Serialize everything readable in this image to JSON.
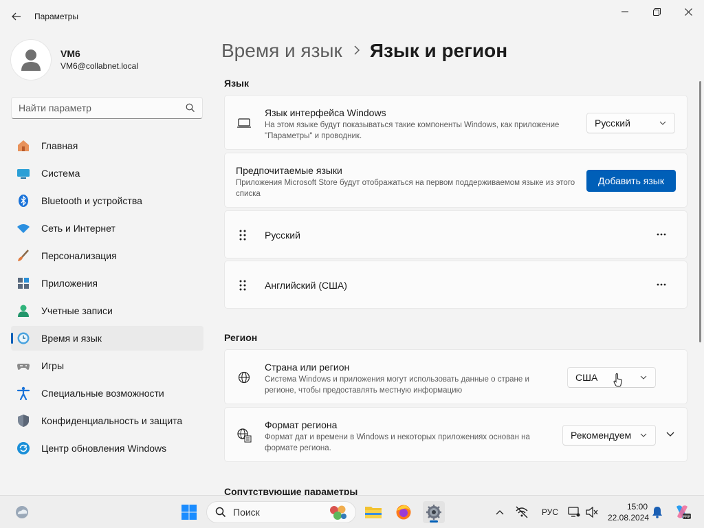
{
  "window": {
    "title": "Параметры"
  },
  "profile": {
    "name": "VM6",
    "email": "VM6@collabnet.local"
  },
  "search": {
    "placeholder": "Найти параметр"
  },
  "nav": {
    "items": [
      {
        "label": "Главная",
        "icon": "home-icon"
      },
      {
        "label": "Система",
        "icon": "system-icon"
      },
      {
        "label": "Bluetooth и устройства",
        "icon": "bluetooth-icon"
      },
      {
        "label": "Сеть и Интернет",
        "icon": "wifi-icon"
      },
      {
        "label": "Персонализация",
        "icon": "brush-icon"
      },
      {
        "label": "Приложения",
        "icon": "apps-icon"
      },
      {
        "label": "Учетные записи",
        "icon": "accounts-icon"
      },
      {
        "label": "Время и язык",
        "icon": "time-language-icon",
        "active": true
      },
      {
        "label": "Игры",
        "icon": "gamepad-icon"
      },
      {
        "label": "Специальные возможности",
        "icon": "accessibility-icon"
      },
      {
        "label": "Конфиденциальность и защита",
        "icon": "shield-icon"
      },
      {
        "label": "Центр обновления Windows",
        "icon": "update-icon"
      }
    ]
  },
  "breadcrumb": {
    "parent": "Время и язык",
    "current": "Язык и регион"
  },
  "language_section": {
    "title": "Язык",
    "display_language": {
      "title": "Язык интерфейса Windows",
      "description": "На этом языке будут показываться такие компоненты Windows, как приложение \"Параметры\" и проводник.",
      "value": "Русский"
    },
    "preferred": {
      "title": "Предпочитаемые языки",
      "description": "Приложения Microsoft Store будут отображаться на первом поддерживаемом языке из этого списка",
      "add_button": "Добавить язык"
    },
    "languages": [
      "Русский",
      "Английский (США)"
    ]
  },
  "region_section": {
    "title": "Регион",
    "country": {
      "title": "Страна или регион",
      "description": "Система Windows и приложения могут использовать данные о стране и регионе, чтобы предоставлять местную информацию",
      "value": "США"
    },
    "format": {
      "title": "Формат региона",
      "description": "Формат дат и времени в Windows и некоторых приложениях основан на формате региона.",
      "value": "Рекомендуем"
    }
  },
  "related_section": {
    "title": "Сопутствующие параметры"
  },
  "taskbar": {
    "search_label": "Поиск",
    "input_language": "РУС",
    "time": "15:00",
    "date": "22.08.2024"
  },
  "colors": {
    "accent": "#005fb8",
    "background": "#f3f3f3",
    "card": "#fbfbfb"
  }
}
